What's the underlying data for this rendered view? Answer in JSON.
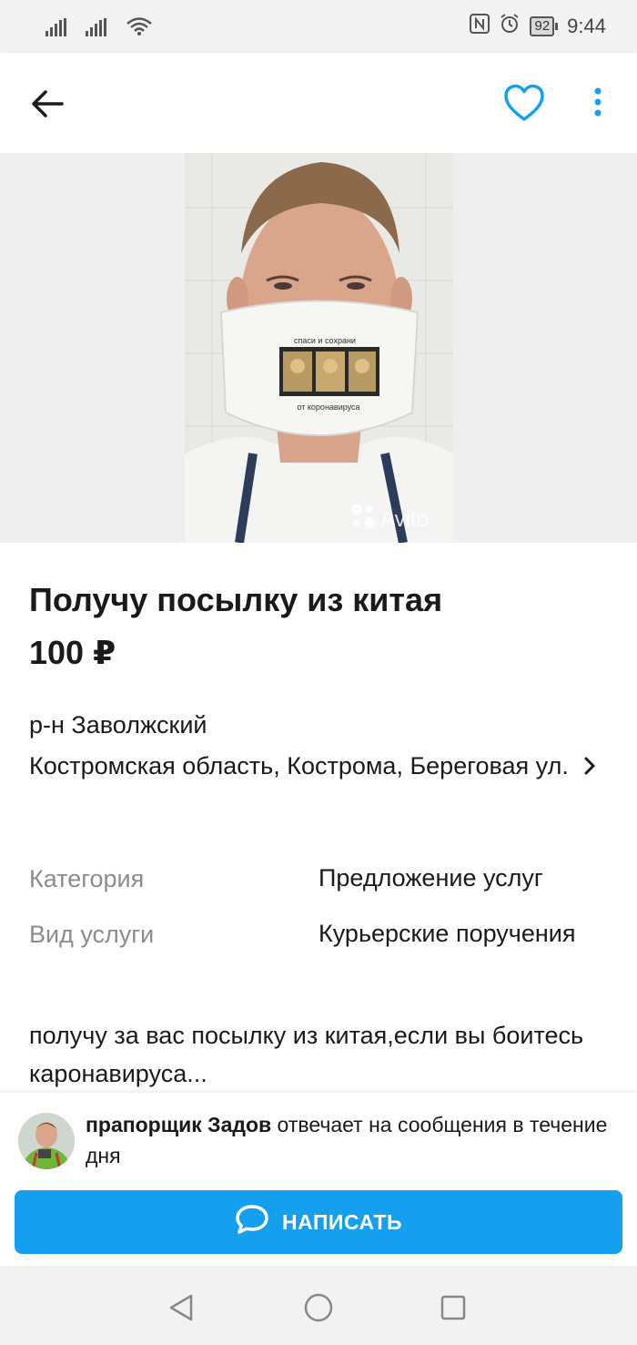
{
  "status_bar": {
    "time": "9:44",
    "battery": "92",
    "icons": [
      "signal-icon",
      "signal-icon",
      "wifi-icon",
      "nfc-icon",
      "alarm-icon",
      "battery-icon"
    ]
  },
  "toolbar": {
    "icons": [
      "back-arrow-icon",
      "heart-icon",
      "more-vertical-icon"
    ]
  },
  "gallery": {
    "watermark": "Avito",
    "mask_text_top": "спаси и сохрани",
    "mask_text_bottom": "от коронавируса"
  },
  "listing": {
    "title": "Получу посылку из китая",
    "price": "100 ₽",
    "district": "р-н Заволжский",
    "address": "Костромская область, Кострома, Береговая ул."
  },
  "properties": [
    {
      "label": "Категория",
      "value": "Предложение услуг"
    },
    {
      "label": "Вид услуги",
      "value": "Курьерские поручения"
    }
  ],
  "description": "получу  за вас посылку из китая,если вы боитесь каронавируса...",
  "seller": {
    "name": "прапорщик Задов",
    "response_text": " отвечает на сообщения в течение дня"
  },
  "write_button": {
    "label": "НАПИСАТЬ"
  },
  "colors": {
    "accent": "#14a0ee",
    "muted_text": "#8c8c8c"
  }
}
